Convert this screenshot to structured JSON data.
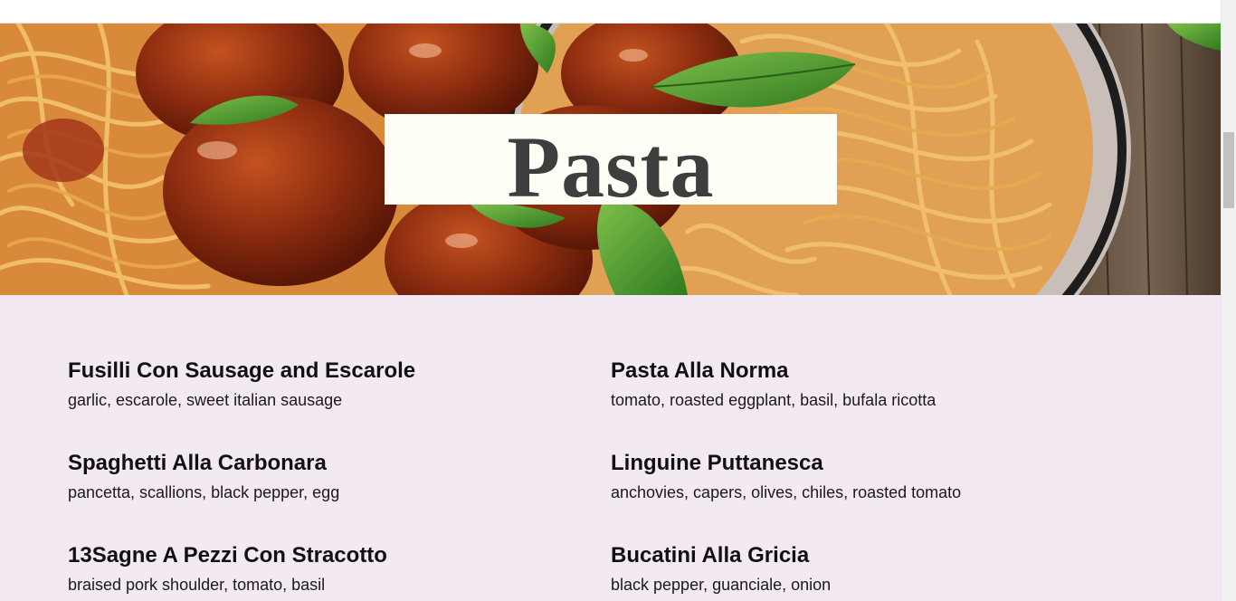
{
  "hero": {
    "title": "Pasta"
  },
  "menu": {
    "items": [
      {
        "name": "Fusilli Con Sausage and Escarole",
        "description": "garlic, escarole, sweet italian sausage"
      },
      {
        "name": "Pasta Alla Norma",
        "description": "tomato, roasted eggplant, basil, bufala ricotta"
      },
      {
        "name": "Spaghetti Alla Carbonara",
        "description": "pancetta, scallions, black pepper, egg"
      },
      {
        "name": "Linguine Puttanesca",
        "description": "anchovies, capers, olives, chiles, roasted tomato"
      },
      {
        "name": "13Sagne A Pezzi Con Stracotto",
        "description": "braised pork shoulder, tomato, basil"
      },
      {
        "name": "Bucatini Alla Gricia",
        "description": "black pepper, guanciale, onion"
      }
    ]
  },
  "colors": {
    "menu_background": "#f3e9f2",
    "title_box": "#fffef6",
    "title_text": "#3e3e3e"
  }
}
